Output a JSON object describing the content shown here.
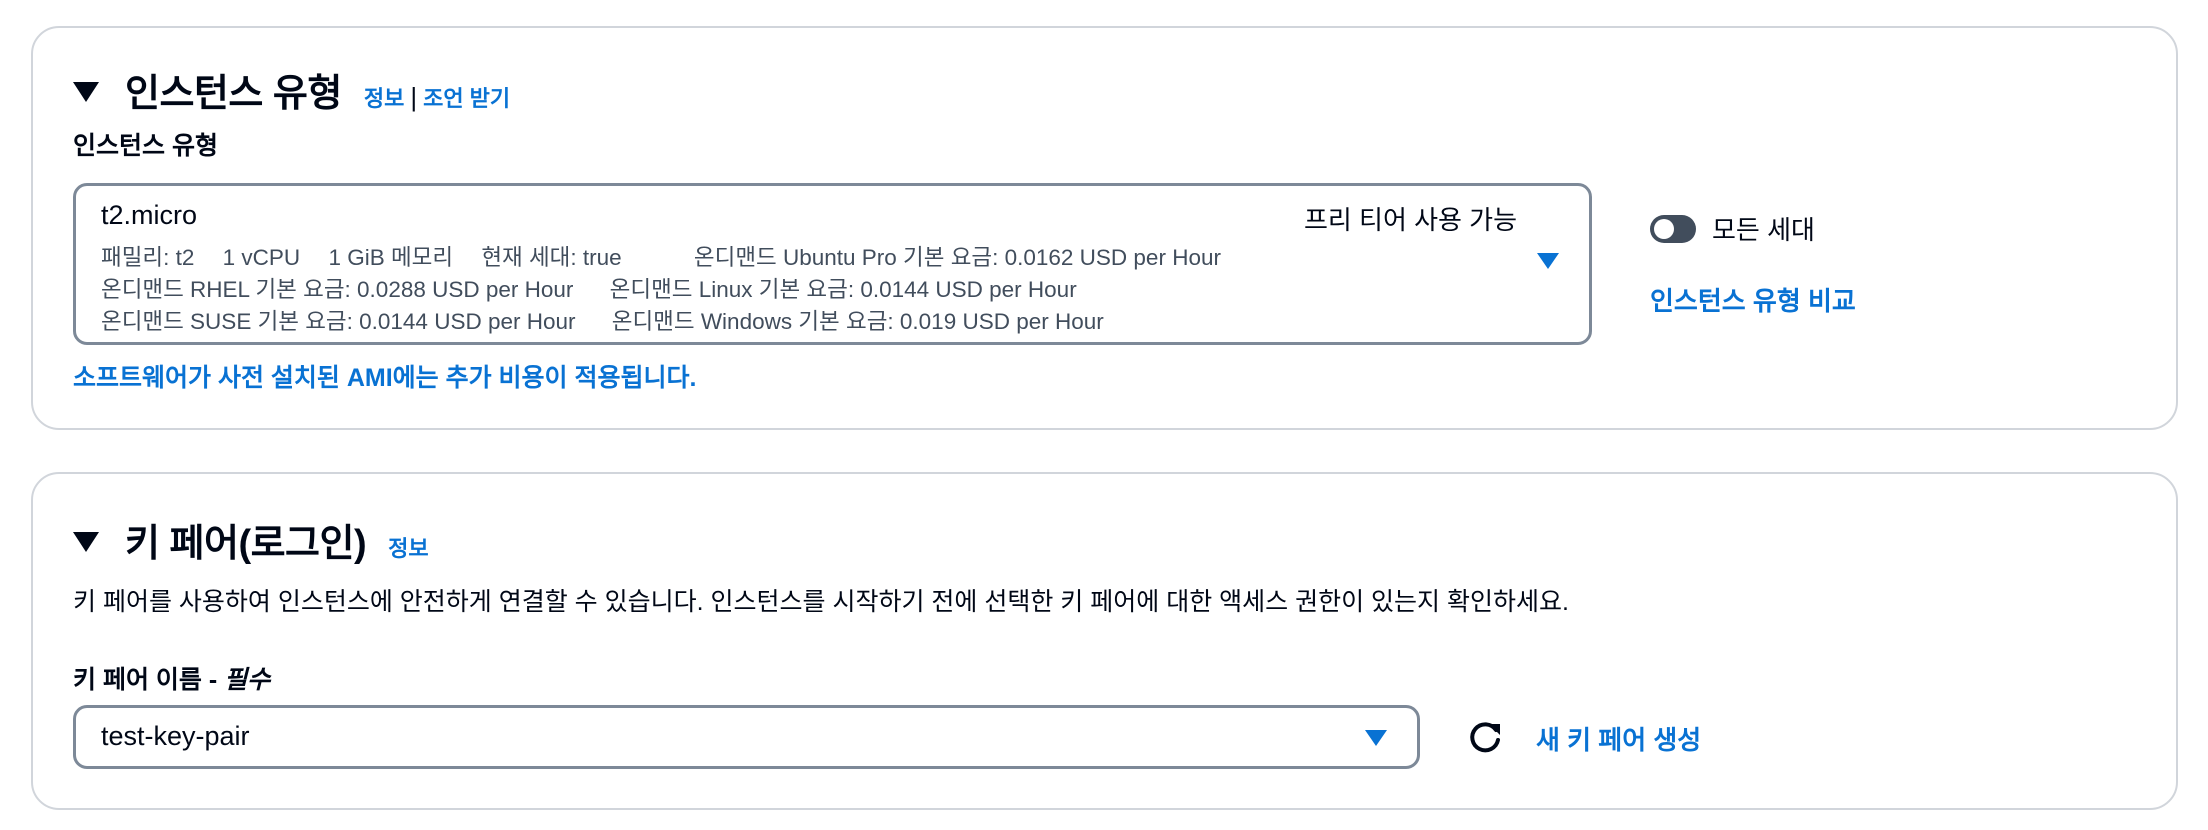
{
  "instance_panel": {
    "title": "인스턴스 유형",
    "info_link": "정보",
    "separator": "|",
    "advice_link": "조언 받기",
    "field_label": "인스턴스 유형",
    "selected": {
      "name": "t2.micro",
      "tag": "프리 티어 사용 가능",
      "family": "패밀리: t2",
      "vcpu": "1 vCPU",
      "memory": "1 GiB 메모리",
      "current_gen": "현재 세대: true",
      "ubuntu_price": "온디맨드 Ubuntu Pro 기본 요금: 0.0162 USD per Hour",
      "rhel_price": "온디맨드 RHEL 기본 요금: 0.0288 USD per Hour",
      "linux_price": "온디맨드 Linux 기본 요금: 0.0144 USD per Hour",
      "suse_price": "온디맨드 SUSE 기본 요금: 0.0144 USD per Hour",
      "windows_price": "온디맨드 Windows 기본 요금: 0.019 USD per Hour"
    },
    "ami_note": "소프트웨어가 사전 설치된 AMI에는 추가 비용이 적용됩니다.",
    "toggle_label": "모든 세대",
    "toggle_on": false,
    "compare_link": "인스턴스 유형 비교"
  },
  "keypair_panel": {
    "title": "키 페어(로그인)",
    "info_link": "정보",
    "description": "키 페어를 사용하여 인스턴스에 안전하게 연결할 수 있습니다. 인스턴스를 시작하기 전에 선택한 키 페어에 대한 액세스 권한이 있는지 확인하세요.",
    "field_label": "키 페어 이름 - ",
    "required_label": "필수",
    "selected_value": "test-key-pair",
    "new_key_link": "새 키 페어 생성"
  },
  "colors": {
    "link": "#0972d3",
    "text": "#000716",
    "secondary_text": "#414d5c",
    "border": "#7d8998",
    "panel_border": "#d1d5db"
  },
  "icons": {
    "collapse": "caret-down-icon",
    "dropdown": "dropdown-arrow-icon",
    "refresh": "refresh-icon"
  }
}
